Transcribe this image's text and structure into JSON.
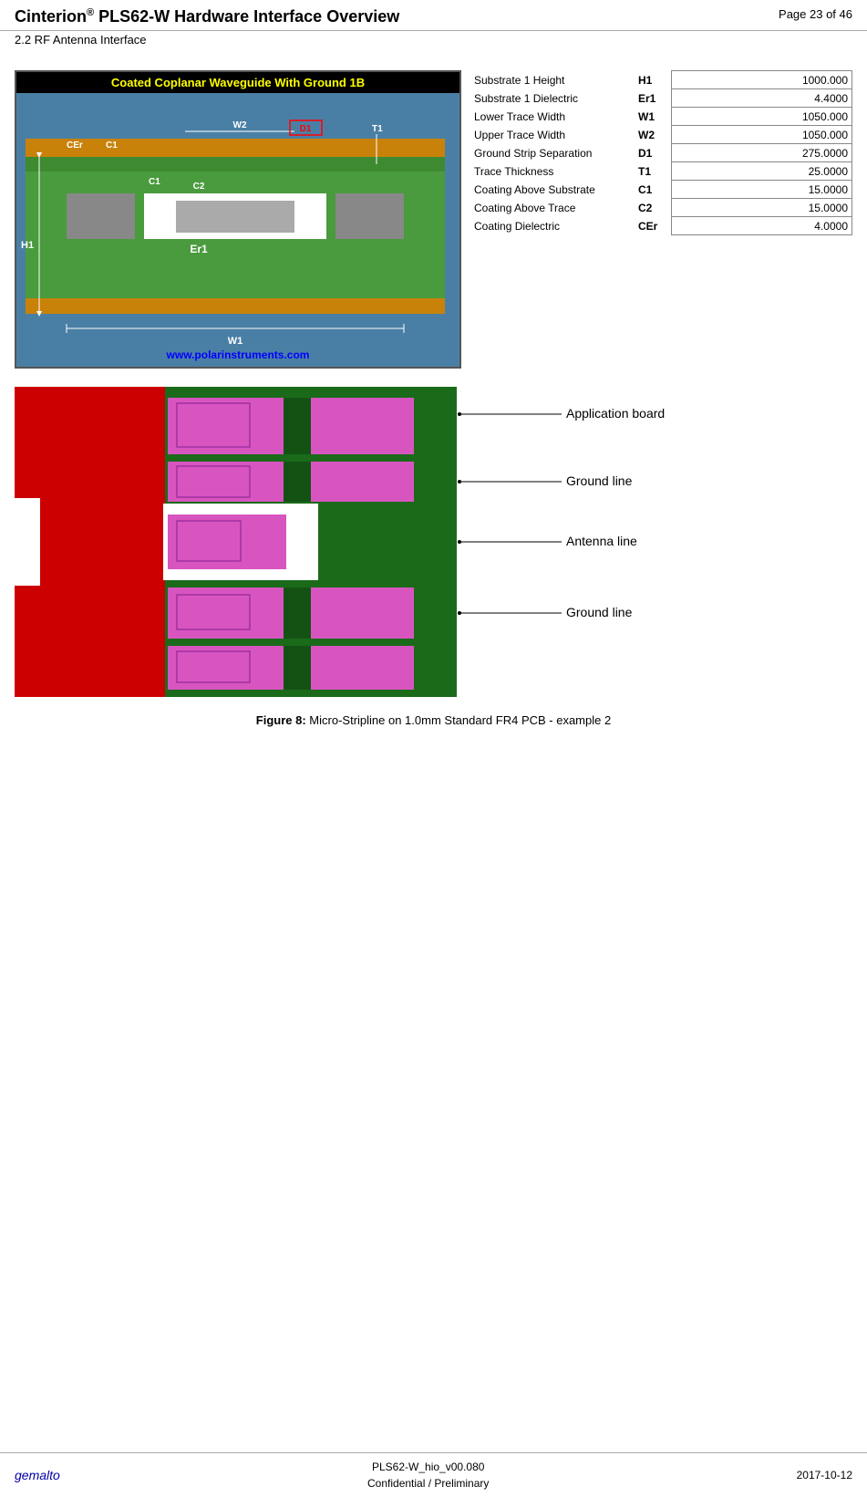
{
  "header": {
    "title": "Cinterion",
    "title_sup": "®",
    "title_rest": " PLS62-W Hardware Interface Overview",
    "page": "Page 23 of 46",
    "subtitle": "2.2 RF Antenna Interface"
  },
  "diagram": {
    "title": "Coated Coplanar Waveguide With Ground 1B",
    "url": "www.polarinstruments.com"
  },
  "parameters": [
    {
      "name": "Substrate 1 Height",
      "symbol": "H1",
      "value": "1000.000"
    },
    {
      "name": "Substrate 1 Dielectric",
      "symbol": "Er1",
      "value": "4.4000"
    },
    {
      "name": "Lower Trace Width",
      "symbol": "W1",
      "value": "1050.000"
    },
    {
      "name": "Upper Trace Width",
      "symbol": "W2",
      "value": "1050.000"
    },
    {
      "name": "Ground Strip Separation",
      "symbol": "D1",
      "value": "275.0000"
    },
    {
      "name": "Trace Thickness",
      "symbol": "T1",
      "value": "25.0000"
    },
    {
      "name": "Coating Above Substrate",
      "symbol": "C1",
      "value": "15.0000"
    },
    {
      "name": "Coating Above Trace",
      "symbol": "C2",
      "value": "15.0000"
    },
    {
      "name": "Coating Dielectric",
      "symbol": "CEr",
      "value": "4.0000"
    }
  ],
  "pcb_labels": {
    "application_board": "Application board",
    "ground_line_top": "Ground line",
    "antenna_line": "Antenna line",
    "ground_line_bottom": "Ground line"
  },
  "figure_caption": {
    "label": "Figure 8:",
    "text": "  Micro-Stripline on 1.0mm Standard FR4 PCB - example 2"
  },
  "footer": {
    "logo": "gemalto",
    "center_line1": "PLS62-W_hio_v00.080",
    "center_line2": "Confidential / Preliminary",
    "date": "2017-10-12"
  }
}
